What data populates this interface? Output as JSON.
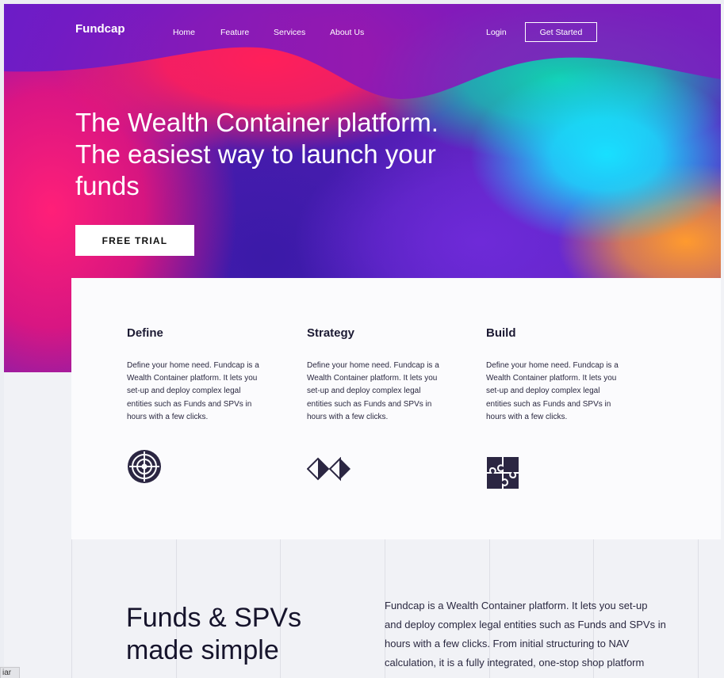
{
  "nav": {
    "logo": "Fundcap",
    "links": [
      "Home",
      "Feature",
      "Services",
      "About Us"
    ],
    "login": "Login",
    "cta": "Get Started"
  },
  "hero": {
    "title": "The Wealth Container platform. The easiest way to launch your funds",
    "button": "FREE TRIAL"
  },
  "features": [
    {
      "title": "Define",
      "description": "Define your home need. Fundcap is a Wealth Container platform. It lets you set-up and deploy complex legal entities such as Funds and SPVs in hours with a few clicks.",
      "icon": "target-icon"
    },
    {
      "title": "Strategy",
      "description": "Define your home need. Fundcap is a Wealth Container platform. It lets you set-up and deploy complex legal entities such as Funds and SPVs in hours with a few clicks.",
      "icon": "diamonds-icon"
    },
    {
      "title": "Build",
      "description": "Define your home need. Fundcap is a Wealth Container platform. It lets you set-up and deploy complex legal entities such as Funds and SPVs in hours with a few clicks.",
      "icon": "puzzle-icon"
    }
  ],
  "funds": {
    "title": "Funds & SPVs made simple",
    "text": "Fundcap is a Wealth Container platform. It lets you set-up and deploy complex legal entities such as Funds and SPVs in hours with a few clicks. From initial structuring to NAV calculation, it is a fully integrated, one-stop shop platform"
  },
  "corner_tab": "iar",
  "colors": {
    "dark": "#1c1a33",
    "white": "#ffffff",
    "page_bg": "#f1f2f6"
  }
}
